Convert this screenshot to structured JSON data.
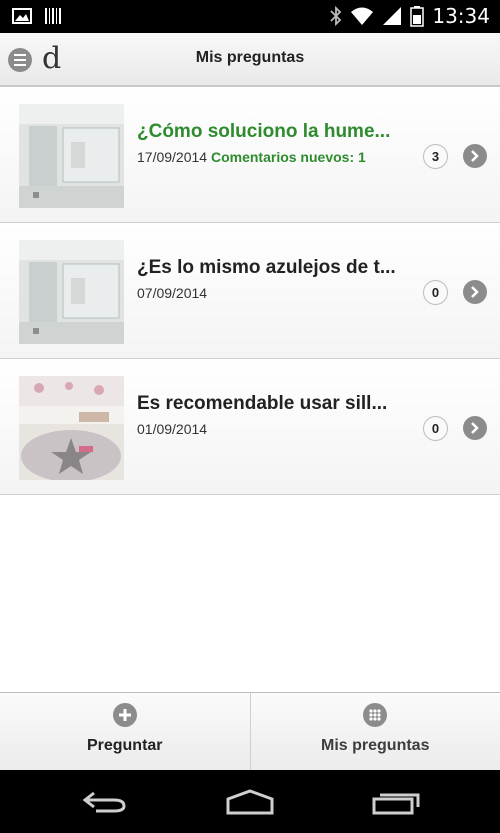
{
  "status_bar": {
    "time": "13:34",
    "icons": [
      "image-icon",
      "barcode-icon",
      "bluetooth-icon",
      "wifi-icon",
      "signal-icon",
      "battery-icon"
    ]
  },
  "header": {
    "logo_text": "d",
    "title": "Mis preguntas"
  },
  "questions": [
    {
      "title": "¿Cómo soluciono la hume...",
      "date": "17/09/2014",
      "new_comments": "Comentarios nuevos: 1",
      "count": "3",
      "highlighted": true
    },
    {
      "title": "¿Es lo mismo azulejos de t...",
      "date": "07/09/2014",
      "new_comments": "",
      "count": "0",
      "highlighted": false
    },
    {
      "title": "Es recomendable usar sill...",
      "date": "01/09/2014",
      "new_comments": "",
      "count": "0",
      "highlighted": false
    }
  ],
  "tabs": [
    {
      "label": "Preguntar",
      "icon": "plus-icon"
    },
    {
      "label": "Mis preguntas",
      "icon": "grid-icon"
    }
  ],
  "colors": {
    "accent_green": "#2e8b2e",
    "icon_gray": "#8c8c8c"
  }
}
